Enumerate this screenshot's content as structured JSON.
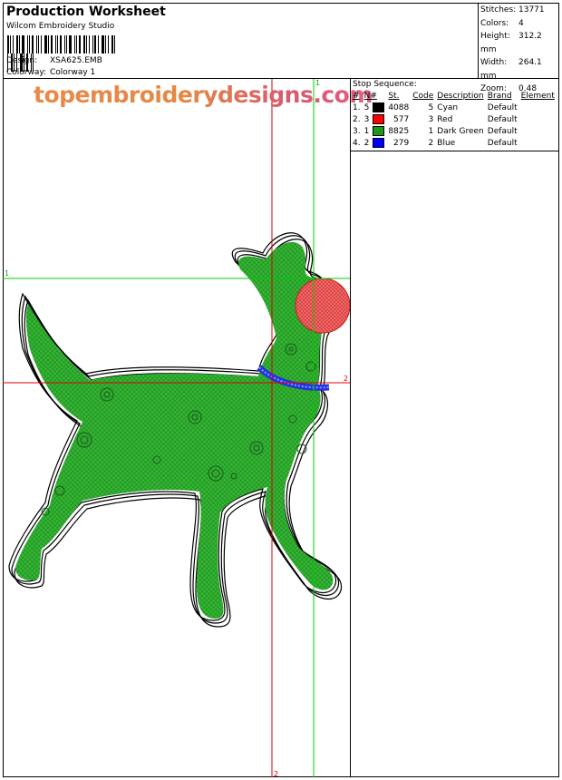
{
  "header": {
    "title": "Production Worksheet",
    "software": "Wilcom Embroidery Studio",
    "design_label": "Design:",
    "design_value": "XSA625.EMB",
    "colorway_label": "Colorway:",
    "colorway_value": "Colorway 1"
  },
  "stats": [
    {
      "label": "Stitches:",
      "value": "13771"
    },
    {
      "label": "Colors:",
      "value": "4"
    },
    {
      "label": "Height:",
      "value": "312.2 mm"
    },
    {
      "label": "Width:",
      "value": "264.1 mm"
    },
    {
      "label": "Zoom:",
      "value": "0.48"
    }
  ],
  "stop_sequence": {
    "title": "Stop Sequence:",
    "headers": [
      "#",
      "N#",
      "St.",
      "Code",
      "Description",
      "Brand",
      "Element"
    ],
    "rows": [
      {
        "num": "1.",
        "n": "5",
        "color": "#000000",
        "st": "4088",
        "code": "5",
        "description": "Cyan",
        "brand": "Default"
      },
      {
        "num": "2.",
        "n": "3",
        "color": "#ff0000",
        "st": "577",
        "code": "3",
        "description": "Red",
        "brand": "Default"
      },
      {
        "num": "3.",
        "n": "1",
        "color": "#1a9a1a",
        "st": "8825",
        "code": "1",
        "description": "Dark Green",
        "brand": "Default"
      },
      {
        "num": "4.",
        "n": "2",
        "color": "#0000ff",
        "st": "279",
        "code": "2",
        "description": "Blue",
        "brand": "Default"
      }
    ]
  },
  "watermark": "topembroiderydesigns.com",
  "guides": {
    "green_v_label": "1",
    "green_h_label": "1",
    "red_h_label": "2",
    "red_v_label": "2"
  },
  "colors": {
    "body_fill": "#33b233",
    "nose_fill": "#e84c4c",
    "collar": "#2233dd",
    "guide_green": "#00cc00",
    "guide_red": "#dd0000"
  }
}
